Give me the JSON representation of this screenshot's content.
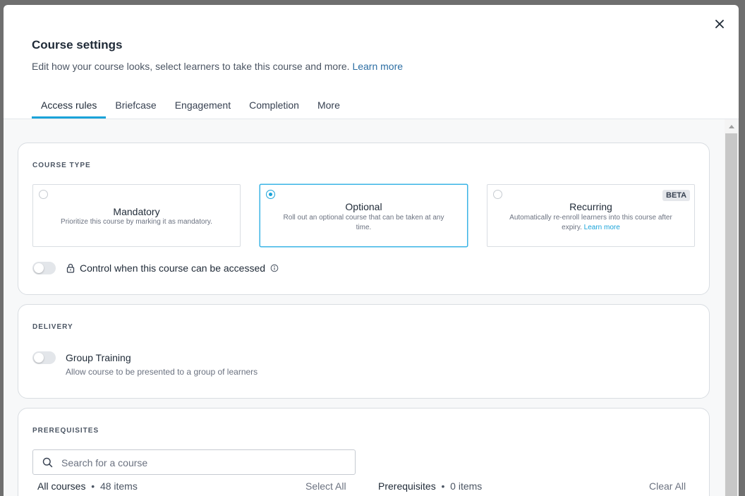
{
  "dialog": {
    "title": "Course settings",
    "subtitle": "Edit how your course looks, select learners to take this course and more.",
    "subtitle_link": "Learn more"
  },
  "tabs": [
    {
      "label": "Access rules",
      "active": true
    },
    {
      "label": "Briefcase",
      "active": false
    },
    {
      "label": "Engagement",
      "active": false
    },
    {
      "label": "Completion",
      "active": false
    },
    {
      "label": "More",
      "active": false
    }
  ],
  "course_type": {
    "heading": "COURSE TYPE",
    "options": [
      {
        "title": "Mandatory",
        "description": "Prioritize this course by marking it as mandatory.",
        "selected": false
      },
      {
        "title": "Optional",
        "description": "Roll out an optional course that can be taken at any time.",
        "selected": true
      },
      {
        "title": "Recurring",
        "description": "Automatically re-enroll learners into this course after expiry.",
        "link": "Learn more",
        "badge": "BETA",
        "selected": false
      }
    ],
    "access_toggle": {
      "label": "Control when this course can be accessed",
      "on": false
    }
  },
  "delivery": {
    "heading": "DELIVERY",
    "group_training": {
      "title": "Group Training",
      "description": "Allow course to be presented to a group of learners",
      "on": false
    }
  },
  "prerequisites": {
    "heading": "PREREQUISITES",
    "search_placeholder": "Search for a course",
    "all_courses": {
      "label": "All courses",
      "separator": "•",
      "count": "48 items",
      "action": "Select All"
    },
    "selected": {
      "label": "Prerequisites",
      "separator": "•",
      "count": "0 items",
      "action": "Clear All"
    }
  },
  "colors": {
    "accent": "#1aa3d9",
    "link": "#2c6ea3"
  }
}
